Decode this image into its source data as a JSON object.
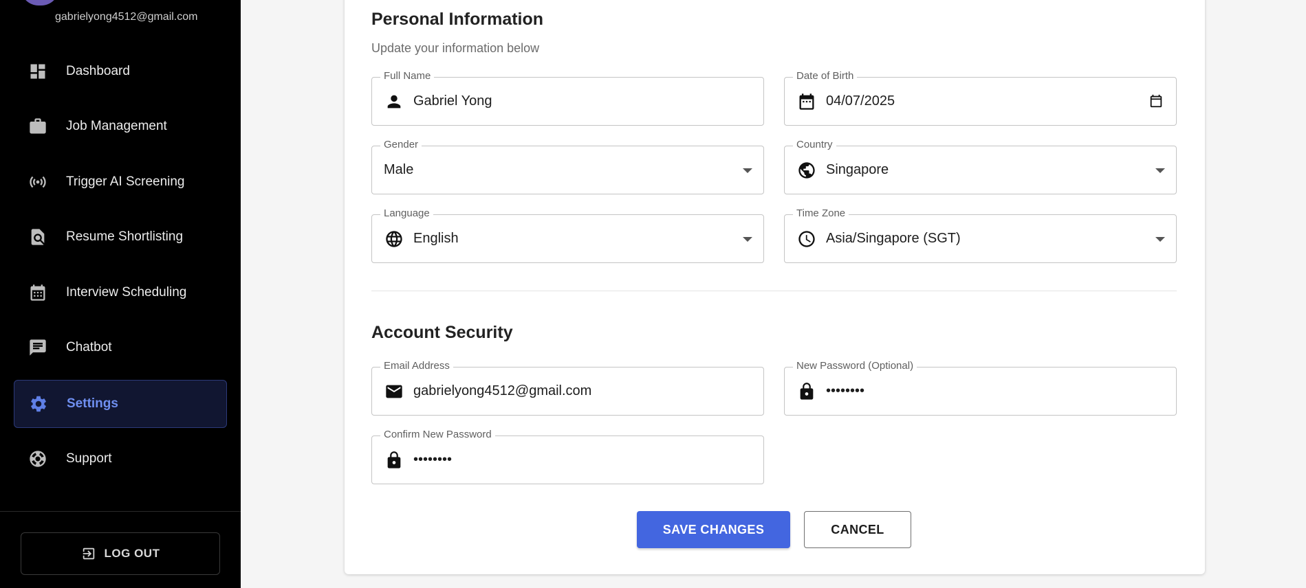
{
  "sidebar": {
    "user_email": "gabrielyong4512@gmail.com",
    "items": [
      {
        "label": "Dashboard",
        "icon": "dashboard-icon"
      },
      {
        "label": "Job Management",
        "icon": "briefcase-icon"
      },
      {
        "label": "Trigger AI Screening",
        "icon": "broadcast-icon"
      },
      {
        "label": "Resume Shortlisting",
        "icon": "document-search-icon"
      },
      {
        "label": "Interview Scheduling",
        "icon": "calendar-icon"
      },
      {
        "label": "Chatbot",
        "icon": "chat-icon"
      },
      {
        "label": "Settings",
        "icon": "gear-icon",
        "active": true
      },
      {
        "label": "Support",
        "icon": "lifebuoy-icon"
      }
    ],
    "logout_label": "LOG OUT"
  },
  "personal": {
    "title": "Personal Information",
    "subtitle": "Update your information below",
    "full_name": {
      "label": "Full Name",
      "value": "Gabriel Yong"
    },
    "dob": {
      "label": "Date of Birth",
      "value": "04/07/2025"
    },
    "gender": {
      "label": "Gender",
      "value": "Male"
    },
    "country": {
      "label": "Country",
      "value": "Singapore"
    },
    "language": {
      "label": "Language",
      "value": "English"
    },
    "timezone": {
      "label": "Time Zone",
      "value": "Asia/Singapore (SGT)"
    }
  },
  "security": {
    "title": "Account Security",
    "email": {
      "label": "Email Address",
      "value": "gabrielyong4512@gmail.com"
    },
    "new_password": {
      "label": "New Password (Optional)",
      "value": "••••••••"
    },
    "confirm_password": {
      "label": "Confirm New Password",
      "value": "••••••••"
    }
  },
  "actions": {
    "save_label": "SAVE CHANGES",
    "cancel_label": "CANCEL"
  },
  "colors": {
    "sidebar_bg": "#000000",
    "active_accent": "#6f8ff0",
    "primary_button": "#4366e0",
    "page_bg": "#f5f5f5"
  }
}
